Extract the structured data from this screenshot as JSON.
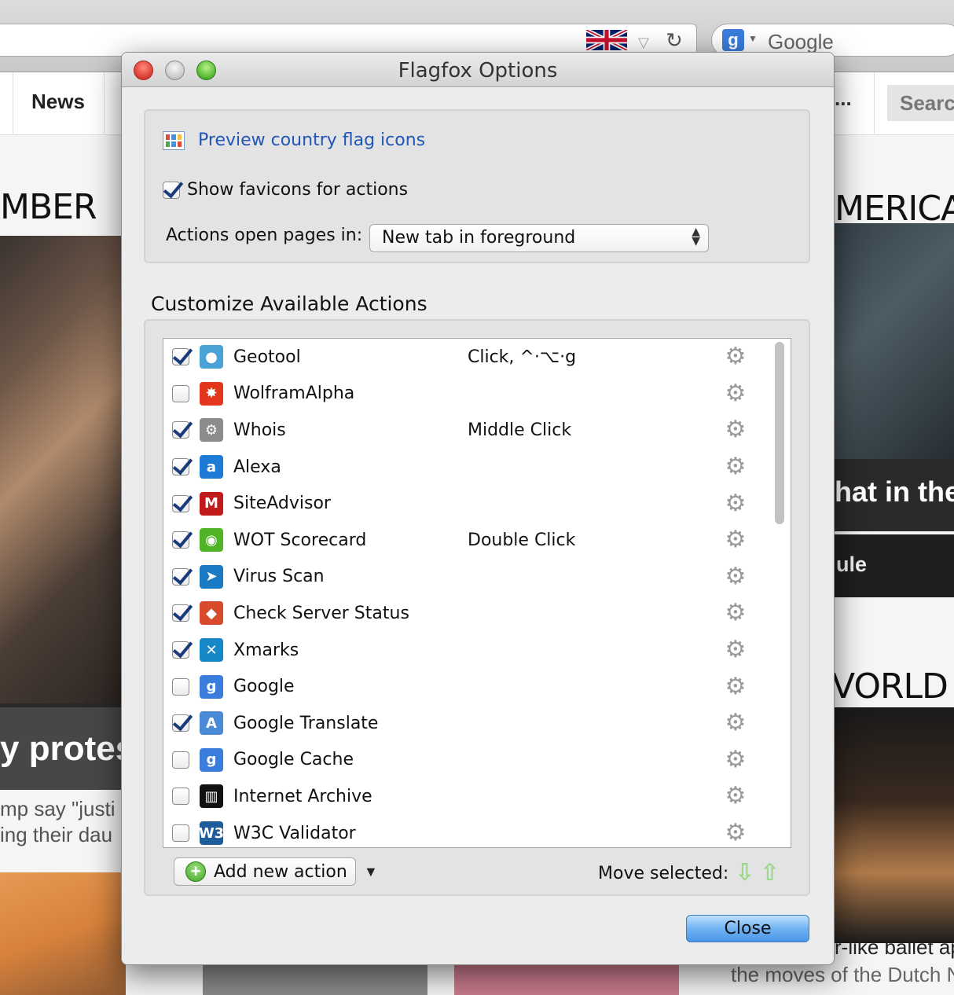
{
  "background": {
    "search_placeholder": "Google",
    "nav_news": "News",
    "nav_dots": "...",
    "nav_search": "Searc",
    "heading_left": "MBER",
    "heading_right": "MERICA",
    "heading_right2": "VORLD I",
    "caption_left": "y protes",
    "text_left_1": "mp say \"justi",
    "text_left_2": "ing their dau",
    "caption_right": "hat in the",
    "caption_right2": "ule",
    "text_right_1": "r-like ballet ap",
    "text_right_2": "the moves of the Dutch N"
  },
  "dialog": {
    "title": "Flagfox Options",
    "preview_link": "Preview country flag icons",
    "show_favicons_label": "Show favicons for actions",
    "show_favicons_checked": true,
    "actions_open_label": "Actions open pages in:",
    "actions_open_value": "New tab in foreground",
    "section_title": "Customize Available Actions",
    "add_action_label": "Add new action",
    "move_selected_label": "Move selected:",
    "close_label": "Close"
  },
  "actions": [
    {
      "name": "Geotool",
      "shortcut": "Click, ^·⌥·g",
      "checked": true,
      "icon": "globe-pin-icon",
      "icon_color": "#4aa3d6",
      "icon_glyph": "●"
    },
    {
      "name": "WolframAlpha",
      "shortcut": "",
      "checked": false,
      "icon": "wolfram-star-icon",
      "icon_color": "#e2371d",
      "icon_glyph": "✸"
    },
    {
      "name": "Whois",
      "shortcut": "Middle Click",
      "checked": true,
      "icon": "whois-gear-icon",
      "icon_color": "#8c8c8c",
      "icon_glyph": "⚙"
    },
    {
      "name": "Alexa",
      "shortcut": "",
      "checked": true,
      "icon": "alexa-icon",
      "icon_color": "#1d7bd6",
      "icon_glyph": "a"
    },
    {
      "name": "SiteAdvisor",
      "shortcut": "",
      "checked": true,
      "icon": "mcafee-shield-icon",
      "icon_color": "#c21a1a",
      "icon_glyph": "M"
    },
    {
      "name": "WOT Scorecard",
      "shortcut": "Double Click",
      "checked": true,
      "icon": "wot-ring-icon",
      "icon_color": "#4fb526",
      "icon_glyph": "◉"
    },
    {
      "name": "Virus Scan",
      "shortcut": "",
      "checked": true,
      "icon": "virustotal-icon",
      "icon_color": "#1a7bc4",
      "icon_glyph": "➤"
    },
    {
      "name": "Check Server Status",
      "shortcut": "",
      "checked": true,
      "icon": "server-status-icon",
      "icon_color": "#d84b2a",
      "icon_glyph": "◆"
    },
    {
      "name": "Xmarks",
      "shortcut": "",
      "checked": true,
      "icon": "xmarks-icon",
      "icon_color": "#1687c7",
      "icon_glyph": "✕"
    },
    {
      "name": "Google",
      "shortcut": "",
      "checked": false,
      "icon": "google-icon",
      "icon_color": "#3b7ddd",
      "icon_glyph": "g"
    },
    {
      "name": "Google Translate",
      "shortcut": "",
      "checked": true,
      "icon": "google-translate-icon",
      "icon_color": "#4a8ad6",
      "icon_glyph": "A"
    },
    {
      "name": "Google Cache",
      "shortcut": "",
      "checked": false,
      "icon": "google-cache-icon",
      "icon_color": "#3b7ddd",
      "icon_glyph": "g"
    },
    {
      "name": "Internet Archive",
      "shortcut": "",
      "checked": false,
      "icon": "archive-building-icon",
      "icon_color": "#111111",
      "icon_glyph": "▥"
    },
    {
      "name": "W3C Validator",
      "shortcut": "",
      "checked": false,
      "icon": "w3c-icon",
      "icon_color": "#1f5c9b",
      "icon_glyph": "W3"
    }
  ]
}
